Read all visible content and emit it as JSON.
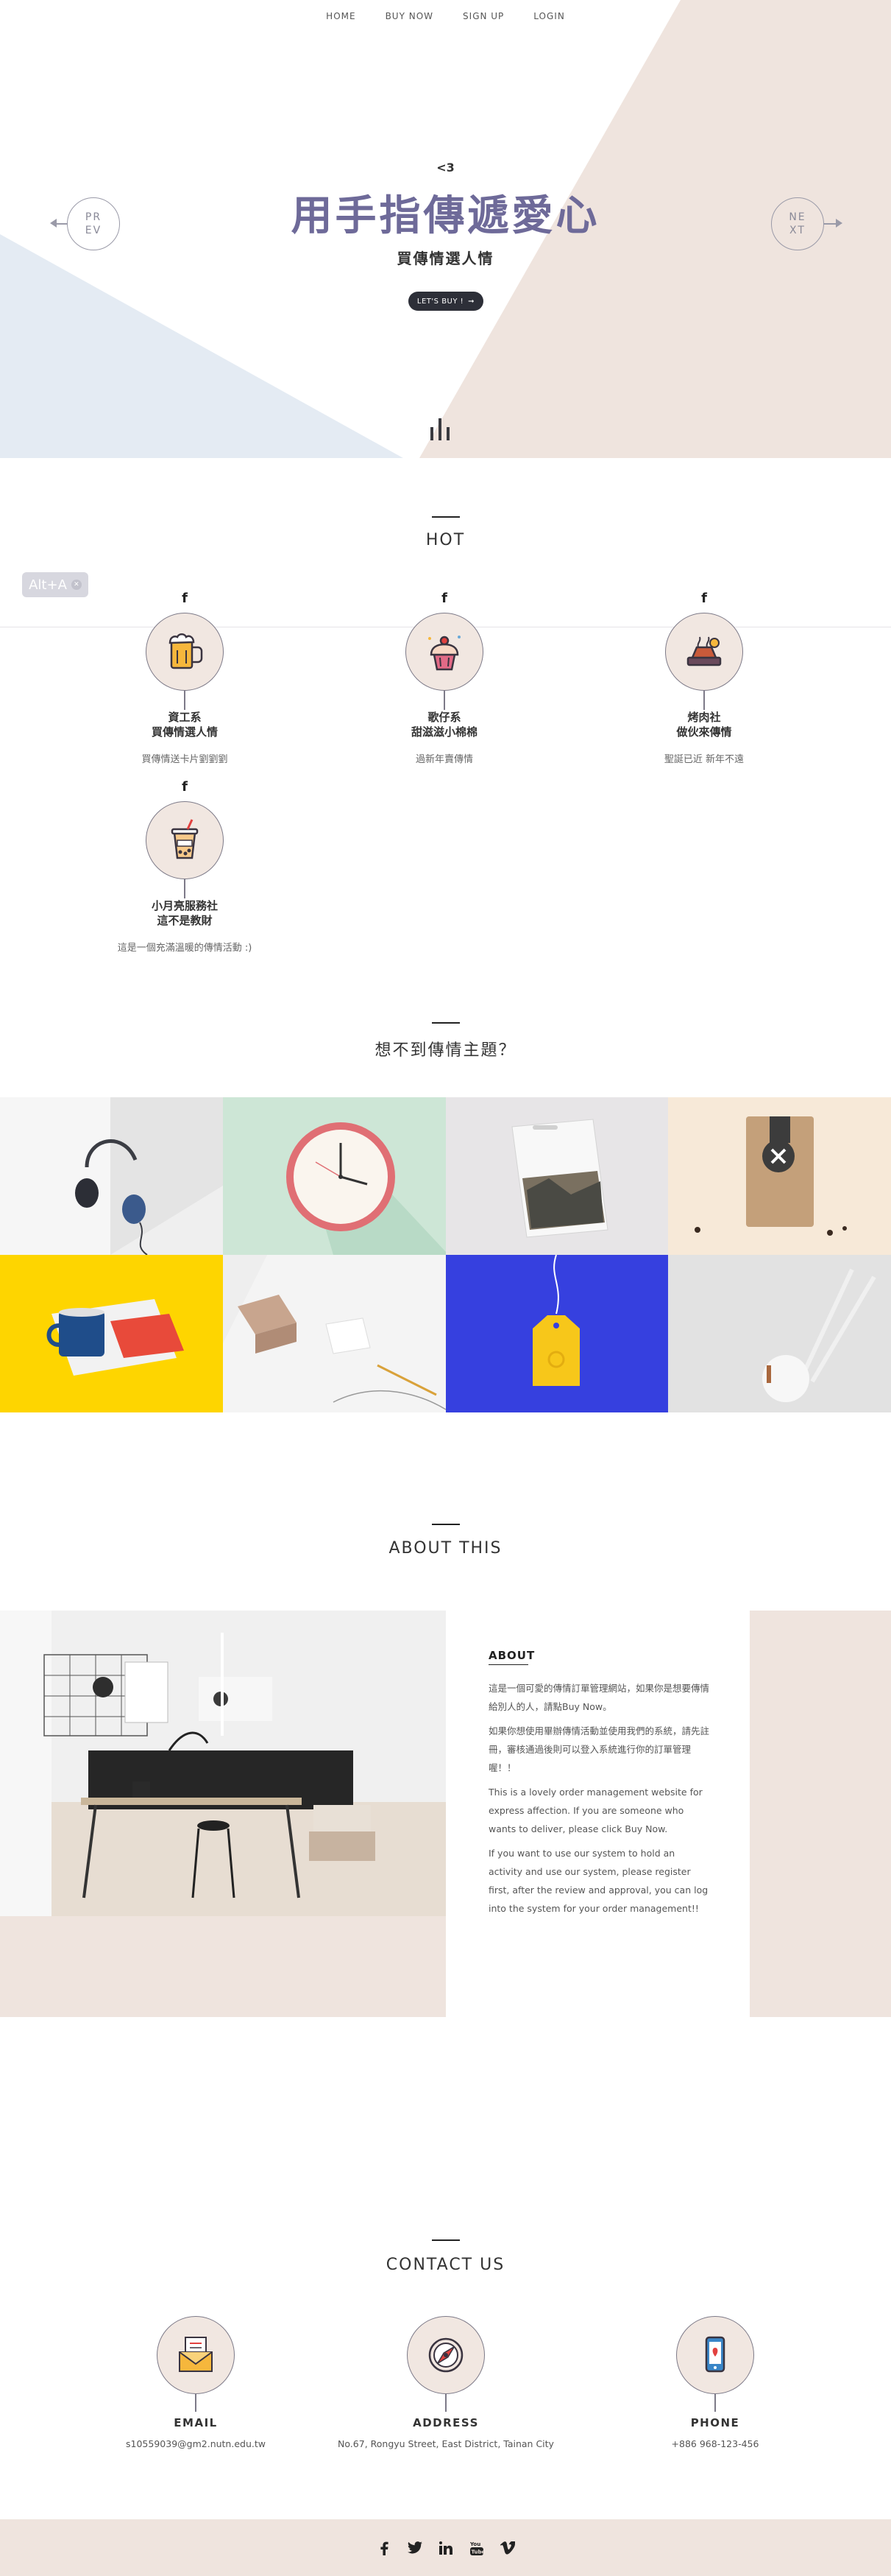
{
  "nav": {
    "items": [
      "HOME",
      "BUY NOW",
      "SIGN UP",
      "LOGIN"
    ]
  },
  "hero": {
    "heart": "<3",
    "title": "用手指傳遞愛心",
    "subtitle": "買傳情選人情",
    "button": "LET'S BUY !",
    "prev": [
      "PR",
      "EV"
    ],
    "next": [
      "NE",
      "XT"
    ],
    "colors": {
      "blue": "#e4ebf3",
      "beige": "#efe4de",
      "title": "#6e6a99"
    }
  },
  "alt_badge": {
    "label": "Alt+A",
    "icon": "close-icon"
  },
  "hot": {
    "title": "HOT",
    "items": [
      {
        "icon": "beer-mug-icon",
        "name": [
          "資工系",
          "買傳情選人情"
        ],
        "desc": "買傳情送卡片劉劉劉"
      },
      {
        "icon": "cupcake-icon",
        "name": [
          "歌仔系",
          "甜滋滋小棉棉"
        ],
        "desc": "過新年賣傳情"
      },
      {
        "icon": "barbecue-icon",
        "name": [
          "烤肉社",
          "做伙來傳情"
        ],
        "desc": "聖誕已近 新年不遠"
      },
      {
        "icon": "bubble-tea-icon",
        "name": [
          "小月亮服務社",
          "這不是教財"
        ],
        "desc": "這是一個充滿溫暖的傳情活動 :)"
      }
    ]
  },
  "themes": {
    "title": "想不到傳情主題？",
    "cells": [
      {
        "name": "headphones",
        "bg": "#efefef"
      },
      {
        "name": "wall-clock",
        "bg": "#cde6d6"
      },
      {
        "name": "photo-book",
        "bg": "#e7e5e7"
      },
      {
        "name": "coffee-bag",
        "bg": "#f7e9d8"
      },
      {
        "name": "mug-and-cards",
        "bg": "#fed500"
      },
      {
        "name": "stationery",
        "bg": "#eeeeee"
      },
      {
        "name": "tag",
        "bg": "#3640df"
      },
      {
        "name": "lamp",
        "bg": "#e2e2e2"
      }
    ]
  },
  "about": {
    "title": "ABOUT THIS",
    "heading": "ABOUT",
    "p1": "這是一個可愛的傳情訂單管理網站，如果你是想要傳情給別人的人，請點Buy Now。",
    "p2": "如果你想使用畢辦傳情活動並使用我們的系統，請先註冊，審核通過後則可以登入系統進行你的訂單管理喔！！",
    "p3": "This is a lovely order management website for express affection. If you are someone who wants to deliver, please click Buy Now.",
    "p4": "If you want to use our system to hold an activity and use our system, please register first, after the review and approval, you can log into the system for your order management!!"
  },
  "contact": {
    "title": "CONTACT US",
    "items": [
      {
        "icon": "envelope-icon",
        "label": "EMAIL",
        "value": "s10559039@gm2.nutn.edu.tw"
      },
      {
        "icon": "compass-icon",
        "label": "ADDRESS",
        "value": "No.67, Rongyu Street, East District, Tainan City"
      },
      {
        "icon": "phone-icon",
        "label": "PHONE",
        "value": "+886 968-123-456"
      }
    ]
  },
  "footer": {
    "icons": [
      "facebook-icon",
      "twitter-icon",
      "linkedin-icon",
      "youtube-icon",
      "vimeo-icon"
    ]
  }
}
